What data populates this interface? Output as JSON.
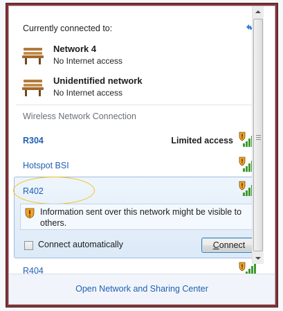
{
  "header": {
    "label": "Currently connected to:",
    "refresh_icon": "refresh-network-icon"
  },
  "connected": [
    {
      "name": "Network  4",
      "status": "No Internet access",
      "icon": "bench-network-icon"
    },
    {
      "name": "Unidentified network",
      "status": "No Internet access",
      "icon": "bench-network-icon"
    }
  ],
  "wireless": {
    "section_label": "Wireless Network Connection",
    "networks": {
      "r304": {
        "name": "R304",
        "extra": "Limited access"
      },
      "hotspot": {
        "name": "Hotspot BSI"
      },
      "r402": {
        "name": "R402"
      },
      "r404": {
        "name": "R404"
      }
    },
    "selected": {
      "warning": "Information sent over this network might be visible to others.",
      "auto_connect_label": "Connect automatically",
      "auto_connect_checked": false,
      "connect_button": "Connect"
    }
  },
  "footer": {
    "link": "Open Network and Sharing Center"
  },
  "colors": {
    "link": "#1f5fb2",
    "highlight": "#f2c316",
    "selection_border": "#9dbbe0",
    "window_frame": "#8a2f33"
  }
}
